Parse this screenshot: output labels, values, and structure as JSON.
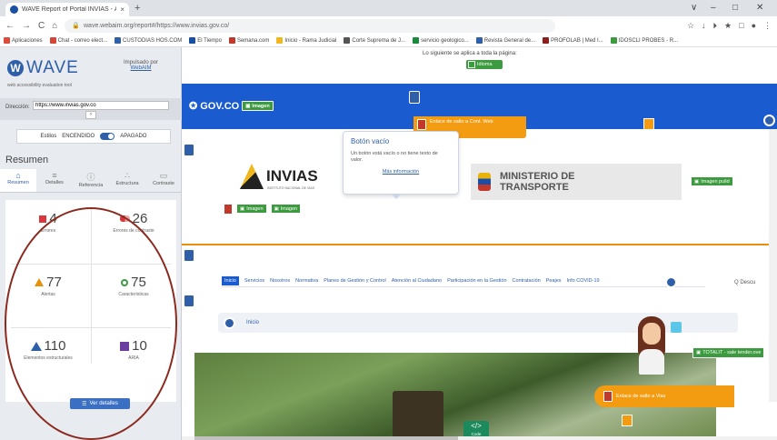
{
  "browser": {
    "tab_title": "WAVE Report of Portal INVIAS - Á...",
    "tab_close": "×",
    "new_tab": "+",
    "window_controls": [
      "∨",
      "–",
      "□",
      "✕"
    ],
    "url": "wave.webaim.org/report#/https://www.invias.gov.co/",
    "nav": [
      "←",
      "→",
      "C",
      "⌂"
    ],
    "extensions": [
      "☆",
      "↓",
      "⏵",
      "★",
      "□",
      "●",
      "⋮"
    ],
    "bookmarks": [
      {
        "label": "Aplicaciones",
        "color": "#e04a3a"
      },
      {
        "label": "Chat - correo elect...",
        "color": "#d44638"
      },
      {
        "label": "CUSTODIAS HOS.COM",
        "color": "#2f5fa8"
      },
      {
        "label": "El Tiempo",
        "color": "#1a4fa3"
      },
      {
        "label": "Semana.com",
        "color": "#c0392b"
      },
      {
        "label": "Inicio - Rama Judicial",
        "color": "#f0b81c"
      },
      {
        "label": "Corte Suprema de J...",
        "color": "#555555"
      },
      {
        "label": "servicio geologico...",
        "color": "#1a8a3c"
      },
      {
        "label": "Revista General de...",
        "color": "#2f5fa8"
      },
      {
        "label": "PROFOLAB | Med I...",
        "color": "#8e1e1e"
      },
      {
        "label": "IDOSCLI PROBES - R...",
        "color": "#3c9a3f"
      }
    ]
  },
  "wave": {
    "logo": "WAVE",
    "logo_letter": "W",
    "tagline": "web accessibility evaluation tool",
    "powered_label": "Impulsado por",
    "powered_link": "WebAIM",
    "address_label": "Dirección:",
    "address_value": "https://www.invias.gov.co",
    "address_go": "›",
    "styles_label": "Estilos",
    "styles_on": "ENCENDIDO",
    "styles_off": "APAGADO",
    "summary_title": "Resumen",
    "tabs": [
      {
        "icon": "⌂",
        "label": "Resumen"
      },
      {
        "icon": "≡",
        "label": "Detalles"
      },
      {
        "icon": "ⓘ",
        "label": "Referencia"
      },
      {
        "icon": "∴",
        "label": "Estructura"
      },
      {
        "icon": "▭",
        "label": "Contraste"
      }
    ],
    "stats": [
      {
        "value": "4",
        "label": "Errores",
        "color": "#d9363e",
        "shape": "square"
      },
      {
        "value": "26",
        "label": "Errores de contraste",
        "color": "#d9363e",
        "shape": "contrast"
      },
      {
        "value": "77",
        "label": "Alertas",
        "color": "#e8900c",
        "shape": "triangle"
      },
      {
        "value": "75",
        "label": "Características",
        "color": "#3c9a3f",
        "shape": "circle"
      },
      {
        "value": "110",
        "label": "Elementos estructurales",
        "color": "#2f5fa8",
        "shape": "structure"
      },
      {
        "value": "10",
        "label": "ARIA",
        "color": "#6b3fa0",
        "shape": "cube"
      }
    ],
    "details_button": "Ver detalles"
  },
  "page": {
    "wave_note": "Lo siguiente se aplica a toda la página:",
    "run_button": "Idioma",
    "govco": "GOV.CO",
    "govco_badge": "Imagen",
    "skip_button": "Enlace de salto a Cont. Web",
    "tooltip_title": "Botón vacío",
    "tooltip_body": "Un botón está vacío o no tiene texto de valor.",
    "tooltip_link": "Más información",
    "invias_name": "INVIAS",
    "invias_sub": "INSTITUTO NACIONAL DE VÍAS",
    "ministerio": "MINISTERIO DE\nTRANSPORTE",
    "logo_badges": [
      "Imagen",
      "Imagen"
    ],
    "ministerio_badge": "Imagen pulid",
    "menu": [
      "Inicio",
      "Servicios",
      "Nosotros",
      "Normativa",
      "Planes de Gestión y Control",
      "Atención al Ciudadano",
      "Participación en la Gestión",
      "Contratación",
      "Peajes",
      "Info COVID-19"
    ],
    "search_tab": "Q  Descu",
    "breadcrumb": "Inicio",
    "skip_avatar": "TOTALIT - sale tender.ove",
    "skip2": "Enlace de salto a Vias",
    "code_glyph": "</>",
    "code_label": "Code"
  }
}
